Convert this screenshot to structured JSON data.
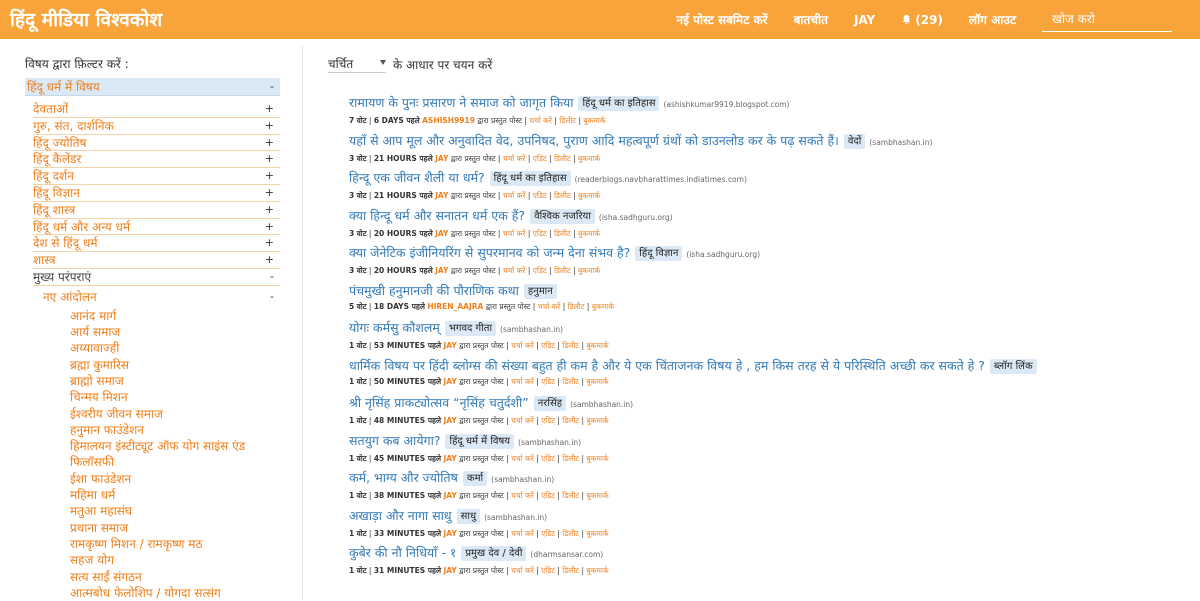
{
  "header": {
    "brand": "हिंदू मीडिया विश्वकोश",
    "nav": {
      "submit": "नई पोस्ट सबमिट करें",
      "chat": "बातचीत",
      "user": "JAY",
      "notifications": "(29)",
      "logout": "लॉग आउट"
    },
    "search_placeholder": "खोज करो"
  },
  "sidebar": {
    "title": "विषय द्वारा फ़िल्टर करें :",
    "root": {
      "label": "हिंदू धर्म में विषय",
      "toggle": "-"
    },
    "categories": [
      {
        "label": "देवताओं",
        "toggle": "+"
      },
      {
        "label": "गुरु, संत, दार्शनिक",
        "toggle": "+"
      },
      {
        "label": "हिंदू ज्योतिष",
        "toggle": "+"
      },
      {
        "label": "हिंदू कैलेंडर",
        "toggle": "+"
      },
      {
        "label": "हिंदू दर्शन",
        "toggle": "+"
      },
      {
        "label": "हिंदू विज्ञान",
        "toggle": "+"
      },
      {
        "label": "हिंदू शास्त्र",
        "toggle": "+"
      },
      {
        "label": "हिंदू धर्म और अन्य धर्म",
        "toggle": "+"
      },
      {
        "label": "देश से हिंदू धर्म",
        "toggle": "+"
      },
      {
        "label": "शास्त्र",
        "toggle": "+"
      }
    ],
    "traditions": {
      "label": "मुख्य परंपराएं",
      "toggle": "-"
    },
    "movements": {
      "label": "नए आंदोलन",
      "toggle": "-"
    },
    "movement_items": [
      "आनंद मार्ग",
      "आर्य समाज",
      "अय्यावाज्ही",
      "ब्रह्मा कुमारिस",
      "ब्राह्मो समाज",
      "चिन्मय मिशन",
      "ईश्वरीय जीवन समाज",
      "हनुमान फाउंडेशन",
      "हिमालयन इंस्टीट्यूट ऑफ योग साइंस एंड फिलॉसफी",
      "ईशा फाउंडेशन",
      "महिमा धर्म",
      "मतुआ महासंघ",
      "प्रधाना समाज",
      "रामकृष्ण मिशन / रामकृष्ण मठ",
      "सहज योग",
      "सत्य साईं संगठन",
      "आत्मबोध फेलोशिप / योगदा सत्संग"
    ]
  },
  "sort": {
    "selected": "चर्चित",
    "suffix": "के आधार पर चयन करें"
  },
  "labels": {
    "votes": "वोट",
    "posted_by": "द्वारा प्रस्तुत पोस्ट",
    "discuss": "चर्चा करें",
    "edit": "एडिट",
    "delete": "डिलीट",
    "bookmark": "बुकमार्क"
  },
  "posts": [
    {
      "title": "रामायण के पुनः प्रसारण ने समाज को जागृत किया",
      "tag": "हिंदू धर्म का इतिहास",
      "domain": "(ashishkumar9919.blogspot.com)",
      "votes": "7",
      "time": "6 DAYS पहले",
      "user": "ASHISH9919",
      "own": false
    },
    {
      "title": "यहाँ से आप मूल और अनुवादित वेद, उपनिषद, पुराण आदि महत्वपूर्ण ग्रंथों को डाउनलोड कर के पढ़ सकते हैं।",
      "tag": "वेदों",
      "domain": "(sambhashan.in)",
      "votes": "3",
      "time": "21 HOURS पहले",
      "user": "JAY",
      "own": true
    },
    {
      "title": "हिन्दू एक जीवन शैली या धर्म?",
      "tag": "हिंदू धर्म का इतिहास",
      "domain": "(readerblogs.navbharattimes.indiatimes.com)",
      "votes": "3",
      "time": "21 HOURS पहले",
      "user": "JAY",
      "own": true
    },
    {
      "title": "क्या हिन्दू धर्म और सनातन धर्म एक हैं?",
      "tag": "वैश्विक नजरिया",
      "domain": "(isha.sadhguru.org)",
      "votes": "3",
      "time": "20 HOURS पहले",
      "user": "JAY",
      "own": true
    },
    {
      "title": "क्या जेनेटिक इंजीनियरिंग से सुपरमानव को जन्म देना संभव है?",
      "tag": "हिंदू विज्ञान",
      "domain": "(isha.sadhguru.org)",
      "votes": "3",
      "time": "20 HOURS पहले",
      "user": "JAY",
      "own": true
    },
    {
      "title": "पंचमुखी हनुमानजी की पौराणिक कथा",
      "tag": "हनुमान",
      "domain": "",
      "votes": "5",
      "time": "18 DAYS पहले",
      "user": "HIREN_AAJRA",
      "own": false
    },
    {
      "title": "योगः कर्मसु कौशलम्",
      "tag": "भगवद गीता",
      "domain": "(sambhashan.in)",
      "votes": "1",
      "time": "53 MINUTES पहले",
      "user": "JAY",
      "own": true
    },
    {
      "title": "धार्मिक विषय पर हिंदी ब्लोग्स की संख्या बहुत ही कम है और ये एक चिंताजनक विषय हे , हम किस तरह से ये परिस्थिति अच्छी कर सकते हे ?",
      "tag": "ब्लॉग लिंक",
      "domain": "",
      "votes": "1",
      "time": "50 MINUTES पहले",
      "user": "JAY",
      "own": true
    },
    {
      "title": "श्री नृसिंह प्राकट्योत्सव “नृसिंह चतुर्दशी”",
      "tag": "नरसिंह",
      "domain": "(sambhashan.in)",
      "votes": "1",
      "time": "48 MINUTES पहले",
      "user": "JAY",
      "own": true
    },
    {
      "title": "सतयुग कब आयेगा?",
      "tag": "हिंदू धर्म में विषय",
      "domain": "(sambhashan.in)",
      "votes": "1",
      "time": "45 MINUTES पहले",
      "user": "JAY",
      "own": true
    },
    {
      "title": "कर्म, भाग्य और ज्योतिष",
      "tag": "कर्मा",
      "domain": "(sambhashan.in)",
      "votes": "1",
      "time": "38 MINUTES पहले",
      "user": "JAY",
      "own": true
    },
    {
      "title": "अखाड़ा और नागा साधु",
      "tag": "साधु",
      "domain": "(sambhashan.in)",
      "votes": "1",
      "time": "33 MINUTES पहले",
      "user": "JAY",
      "own": true
    },
    {
      "title": "कुबेर की नौ निधियाँ - १",
      "tag": "प्रमुख देव / देवी",
      "domain": "(dharmsansar.com)",
      "votes": "1",
      "time": "31 MINUTES पहले",
      "user": "JAY",
      "own": true
    }
  ],
  "colors": {
    "header_bg": "#f9a43a",
    "accent": "#ef7f1a",
    "link": "#337ab7",
    "tag_bg": "#dbe9f6"
  }
}
